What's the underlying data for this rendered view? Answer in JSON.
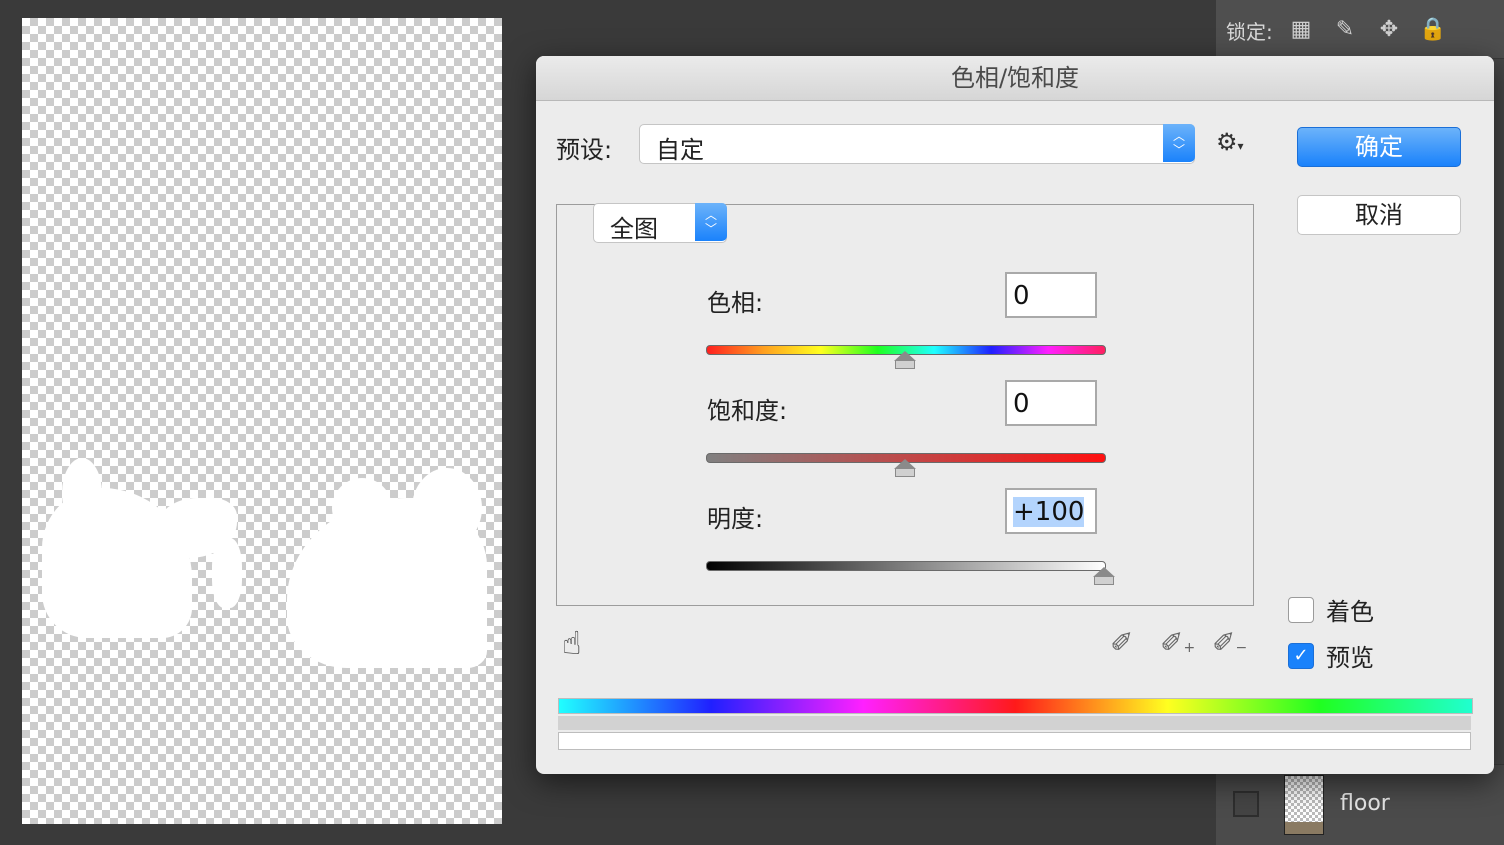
{
  "dialog": {
    "title": "色相/饱和度",
    "preset_label": "预设:",
    "preset_value": "自定",
    "ok_label": "确定",
    "cancel_label": "取消",
    "channel_value": "全图",
    "hue": {
      "label": "色相:",
      "value": "0",
      "slider_position": 0.5
    },
    "saturation": {
      "label": "饱和度:",
      "value": "0",
      "slider_position": 0.5
    },
    "lightness": {
      "label": "明度:",
      "value": "+100",
      "slider_position": 1.0
    },
    "colorize_label": "着色",
    "colorize_checked": false,
    "preview_label": "预览",
    "preview_checked": true
  },
  "layers_panel": {
    "lock_label": "锁定:",
    "layer_name": "floor"
  },
  "icons": {
    "gear": "gear-icon",
    "hand": "targeted-adjustment-hand-icon",
    "eyedropper": "eyedropper-icon",
    "eyedropper_plus": "eyedropper-add-icon",
    "eyedropper_minus": "eyedropper-subtract-icon",
    "lock_transparent": "lock-transparency-icon",
    "lock_brush": "lock-pixels-icon",
    "lock_move": "lock-position-icon",
    "lock_all": "lock-all-icon"
  },
  "colors": {
    "accent": "#1a82fb",
    "dialog_bg": "#ececec",
    "workspace_bg": "#3a3a3a"
  }
}
